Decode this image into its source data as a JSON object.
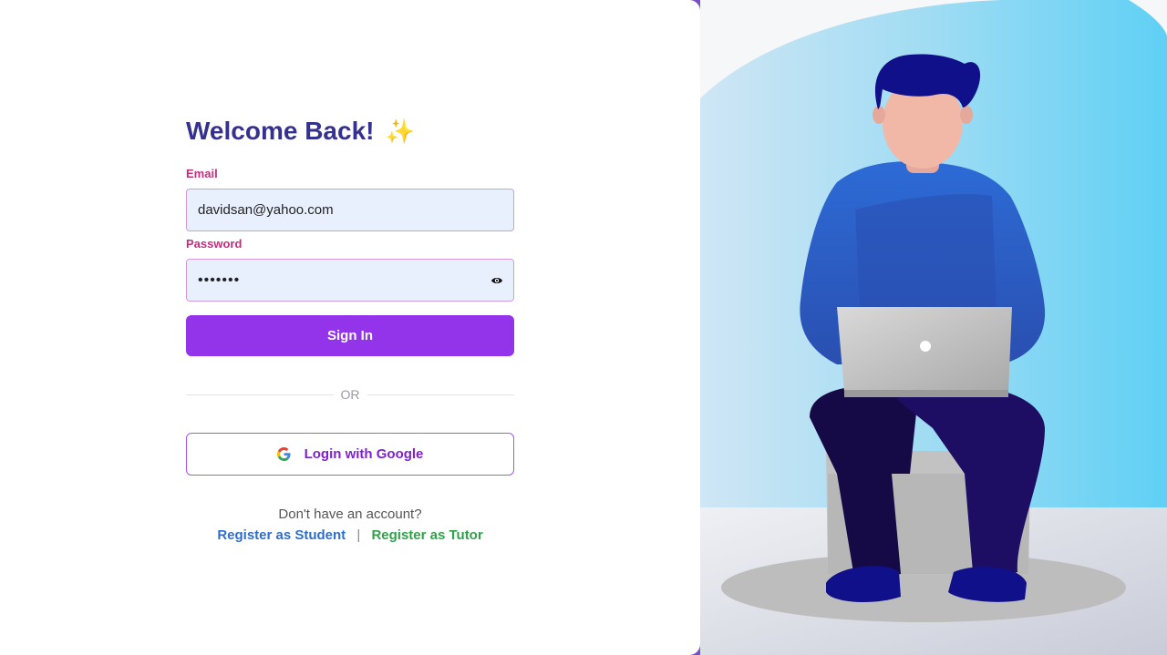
{
  "login": {
    "title": "Welcome Back!",
    "sparkle_icon": "✨",
    "email_label": "Email",
    "email_value": "davidsan@yahoo.com",
    "password_label": "Password",
    "password_value": "1234567",
    "signin_label": "Sign In",
    "or_label": "OR",
    "google_label": "Login with Google",
    "no_account_text": "Don't have an account?",
    "register_student": "Register as Student",
    "separator": "|",
    "register_tutor": "Register as Tutor"
  },
  "colors": {
    "title": "#35318f",
    "label": "#c2307d",
    "primary_button": "#9333ea",
    "input_bg": "#e8effd",
    "student_link": "#2e6fce",
    "tutor_link": "#2fa34a"
  },
  "icons": {
    "password_toggle": "eye-icon",
    "google": "google-icon",
    "illustration": "person-with-laptop-illustration"
  }
}
